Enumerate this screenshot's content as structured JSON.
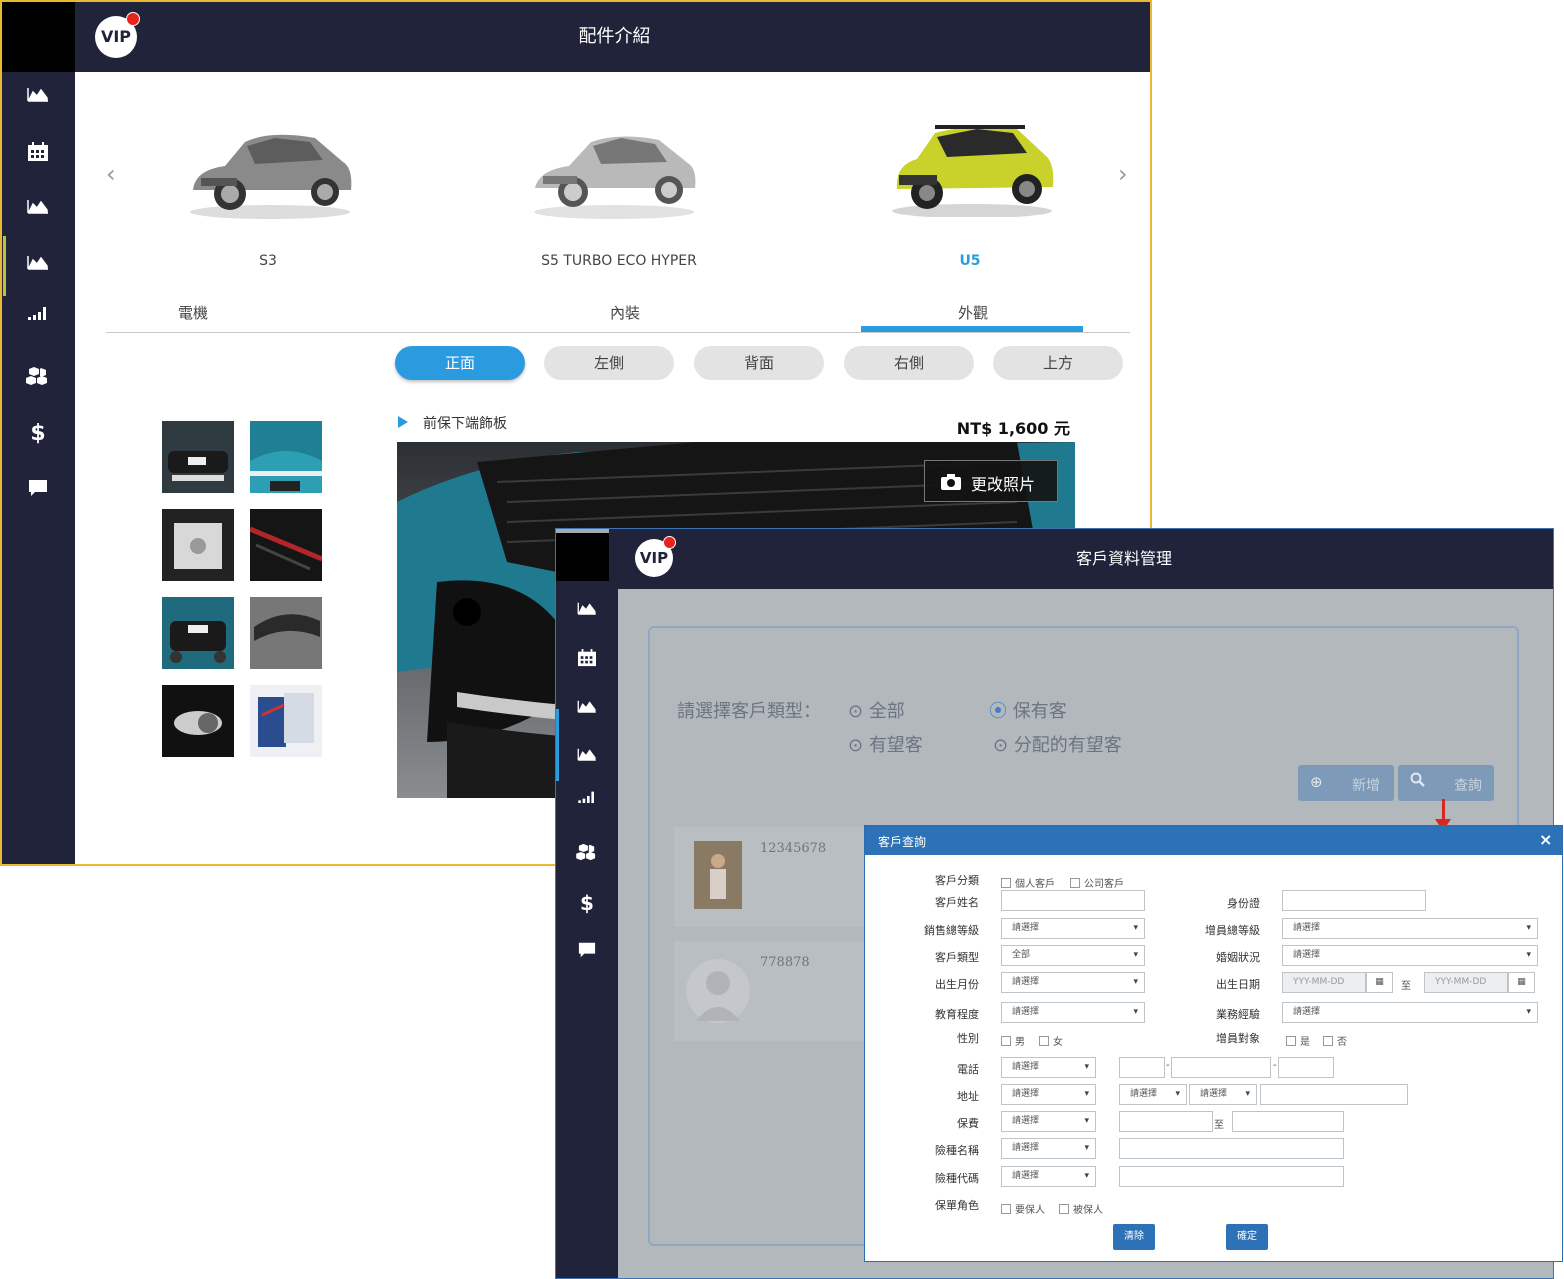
{
  "win1": {
    "title": "配件介紹",
    "vip": "VIP",
    "cars": [
      {
        "label": "S3"
      },
      {
        "label": "S5 TURBO ECO HYPER"
      },
      {
        "label": "U5"
      }
    ],
    "tabs": [
      "電機",
      "內裝",
      "外觀"
    ],
    "views": [
      "正面",
      "左側",
      "背面",
      "右側",
      "上方"
    ],
    "part_name": "前保下端飾板",
    "price": "NT$ 1,600 元",
    "change_photo": "更改照片"
  },
  "win2": {
    "title": "客戶資料管理",
    "vip": "VIP",
    "type_prompt": "請選擇客戶類型：",
    "types": [
      "全部",
      "保有客",
      "有望客",
      "分配的有望客"
    ],
    "add_label": "新增",
    "search_label": "查詢",
    "customers": [
      {
        "id": "12345678"
      },
      {
        "id": "778878"
      }
    ]
  },
  "modal": {
    "title": "客戶查詢",
    "close": "×",
    "labels": {
      "category": "客戶分類",
      "name": "客戶姓名",
      "id_card": "身份證",
      "sales_level": "銷售總等級",
      "member_level": "增員總等級",
      "type": "客戶類型",
      "marital": "婚姻狀況",
      "birth_month": "出生月份",
      "birth_date": "出生日期",
      "education": "教育程度",
      "experience": "業務經驗",
      "gender": "性別",
      "recruit": "增員對象",
      "phone": "電話",
      "address": "地址",
      "premium": "保費",
      "ins_name": "險種名稱",
      "ins_code": "險種代碼",
      "role": "保單角色"
    },
    "options": {
      "personal": "個人客戶",
      "company": "公司客戶",
      "male": "男",
      "female": "女",
      "yes": "是",
      "no": "否",
      "insurer": "要保人",
      "insured": "被保人"
    },
    "select_placeholder": "請選擇",
    "type_value": "全部",
    "date_placeholder": "YYY-MM-DD",
    "to": "至",
    "dash": "-",
    "clear": "清除",
    "confirm": "確定"
  }
}
